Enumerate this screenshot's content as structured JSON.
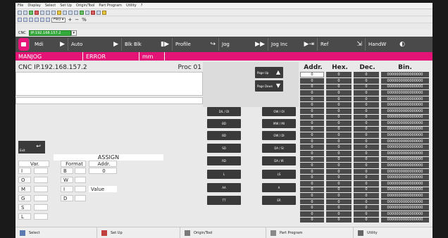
{
  "menu": [
    "File",
    "Display",
    "Select",
    "Set Up",
    "Origin/Tool",
    "Part Program",
    "Utility",
    "?"
  ],
  "toolbar2": {
    "combo": "FRO",
    "plus": "+",
    "minus": "−",
    "fraction": "%"
  },
  "cnc_line": {
    "label": "CNC",
    "ip_short": "IP:192.168.157.2"
  },
  "modes": [
    {
      "label": "Mdi",
      "glyph": "▶"
    },
    {
      "label": "Auto",
      "glyph": "▶"
    },
    {
      "label": "Blk Blk",
      "glyph": "▶▶"
    },
    {
      "label": "Profile",
      "glyph": "✎"
    },
    {
      "label": "Jog",
      "glyph": "▶▶"
    },
    {
      "label": "Jog Inc",
      "glyph": "▶▶"
    },
    {
      "label": "Ref",
      "glyph": "▶"
    },
    {
      "label": "HandW",
      "glyph": "⚙"
    }
  ],
  "status": {
    "mode": "MANJOG",
    "error": "ERROR",
    "unit": "mm"
  },
  "cnc_title": {
    "left": "CNC  IP.192.168.157.2",
    "proc": "Proc 01"
  },
  "page_buttons": {
    "up": "Page Up",
    "down": "Page Down"
  },
  "keys": [
    [
      "D/L / DI",
      "OW / OI"
    ],
    [
      "BD",
      "MW / MI"
    ],
    [
      "BD",
      "OW / DI"
    ],
    [
      "SD",
      "DA / SI"
    ],
    [
      "RD",
      "DA / IR"
    ],
    [
      "L",
      "LS"
    ],
    [
      "AA",
      "A"
    ],
    [
      "TT",
      "ER"
    ]
  ],
  "registers": {
    "headers": {
      "addr": "Addr.",
      "hex": "Hex.",
      "dec": "Dec.",
      "bin": "Bin."
    },
    "rows": [
      {
        "addr": "0",
        "hex": "0",
        "dec": "0",
        "bin": "0000000000000000"
      },
      {
        "addr": "0",
        "hex": "0",
        "dec": "0",
        "bin": "0000000000000000"
      },
      {
        "addr": "0",
        "hex": "0",
        "dec": "0",
        "bin": "0000000000000000"
      },
      {
        "addr": "0",
        "hex": "0",
        "dec": "0",
        "bin": "0000000000000000"
      },
      {
        "addr": "0",
        "hex": "0",
        "dec": "0",
        "bin": "0000000000000000"
      },
      {
        "addr": "0",
        "hex": "0",
        "dec": "0",
        "bin": "0000000000000000"
      },
      {
        "addr": "0",
        "hex": "0",
        "dec": "0",
        "bin": "0000000000000000"
      },
      {
        "addr": "0",
        "hex": "0",
        "dec": "0",
        "bin": "0000000000000000"
      },
      {
        "addr": "0",
        "hex": "0",
        "dec": "0",
        "bin": "0000000000000000"
      },
      {
        "addr": "0",
        "hex": "0",
        "dec": "0",
        "bin": "0000000000000000"
      },
      {
        "addr": "0",
        "hex": "0",
        "dec": "0",
        "bin": "0000000000000000"
      },
      {
        "addr": "0",
        "hex": "0",
        "dec": "0",
        "bin": "0000000000000000"
      },
      {
        "addr": "0",
        "hex": "0",
        "dec": "0",
        "bin": "0000000000000000"
      },
      {
        "addr": "0",
        "hex": "0",
        "dec": "0",
        "bin": "0000000000000000"
      },
      {
        "addr": "0",
        "hex": "0",
        "dec": "0",
        "bin": "0000000000000000"
      },
      {
        "addr": "0",
        "hex": "0",
        "dec": "0",
        "bin": "0000000000000000"
      },
      {
        "addr": "0",
        "hex": "0",
        "dec": "0",
        "bin": "0000000000000000"
      },
      {
        "addr": "0",
        "hex": "0",
        "dec": "0",
        "bin": "0000000000000000"
      },
      {
        "addr": "0",
        "hex": "0",
        "dec": "0",
        "bin": "0000000000000000"
      },
      {
        "addr": "0",
        "hex": "0",
        "dec": "0",
        "bin": "0000000000000000"
      },
      {
        "addr": "0",
        "hex": "0",
        "dec": "0",
        "bin": "0000000000000000"
      },
      {
        "addr": "0",
        "hex": "0",
        "dec": "0",
        "bin": "0000000000000000"
      },
      {
        "addr": "0",
        "hex": "0",
        "dec": "0",
        "bin": "0000000000000000"
      },
      {
        "addr": "0",
        "hex": "0",
        "dec": "0",
        "bin": "0000000000000000"
      },
      {
        "addr": "0",
        "hex": "0",
        "dec": "0",
        "bin": "0000000000000000"
      }
    ]
  },
  "exit_label": "Exit",
  "assign": {
    "title": "ASSIGN",
    "var_header": "Var.",
    "format_header": "Format",
    "addr_header": "Addr.",
    "addr_value": "0",
    "value_label": "Value",
    "vars": [
      "I",
      "O",
      "M",
      "G",
      "S",
      "L"
    ],
    "formats": [
      "B",
      "W",
      "I",
      "D"
    ]
  },
  "bottom": [
    "Select",
    "Set Up",
    "Origin/Tool",
    "Part Program",
    "Utility"
  ],
  "colors": {
    "accent": "#e31475",
    "dark": "#4a4a4a",
    "ip_green": "#33aa3a"
  }
}
